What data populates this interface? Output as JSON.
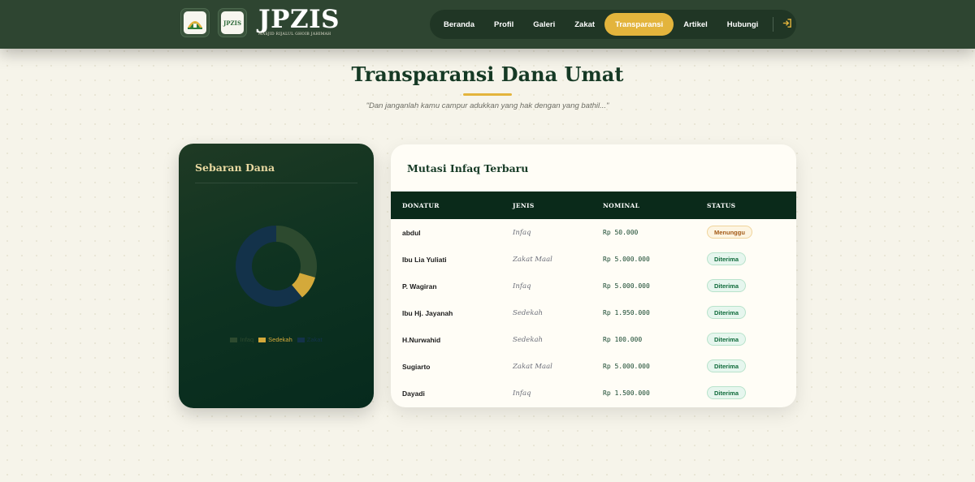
{
  "header": {
    "brand_title": "JPZIS",
    "brand_subtitle": "MASJID RIJALUL GHOIB JAHIMAH",
    "logo_text": "JPZIS",
    "nav": [
      {
        "label": "Beranda",
        "active": false
      },
      {
        "label": "Profil",
        "active": false
      },
      {
        "label": "Galeri",
        "active": false
      },
      {
        "label": "Zakat",
        "active": false
      },
      {
        "label": "Transparansi",
        "active": true
      },
      {
        "label": "Artikel",
        "active": false
      },
      {
        "label": "Hubungi",
        "active": false
      }
    ],
    "login_icon": "login-icon"
  },
  "page": {
    "title": "Transparansi Dana Umat",
    "quote": "\"Dan janganlah kamu campur adukkan yang hak dengan yang bathil...\""
  },
  "chart_card": {
    "title": "Sebaran Dana"
  },
  "chart_data": {
    "type": "pie",
    "categories": [
      "Infaq",
      "Sedekah",
      "Zakat"
    ],
    "values": [
      29.5,
      9.5,
      61
    ],
    "colors": [
      "#2d4a2f",
      "#d4a93a",
      "#13324a"
    ],
    "legend": "bottom",
    "title": "Sebaran Dana"
  },
  "table_card": {
    "title": "Mutasi Infaq Terbaru",
    "columns": [
      "DONATUR",
      "JENIS",
      "NOMINAL",
      "STATUS"
    ],
    "rows": [
      {
        "donatur": "abdul",
        "jenis": "Infaq",
        "nominal": "Rp 50.000",
        "status": "Menunggu",
        "state": "wait"
      },
      {
        "donatur": "Ibu Lia Yuliati",
        "jenis": "Zakat Maal",
        "nominal": "Rp 5.000.000",
        "status": "Diterima",
        "state": "ok"
      },
      {
        "donatur": "P. Wagiran",
        "jenis": "Infaq",
        "nominal": "Rp 5.000.000",
        "status": "Diterima",
        "state": "ok"
      },
      {
        "donatur": "Ibu Hj. Jayanah",
        "jenis": "Sedekah",
        "nominal": "Rp 1.950.000",
        "status": "Diterima",
        "state": "ok"
      },
      {
        "donatur": "H.Nurwahid",
        "jenis": "Sedekah",
        "nominal": "Rp 100.000",
        "status": "Diterima",
        "state": "ok"
      },
      {
        "donatur": "Sugiarto",
        "jenis": "Zakat Maal",
        "nominal": "Rp 5.000.000",
        "status": "Diterima",
        "state": "ok"
      },
      {
        "donatur": "Dayadi",
        "jenis": "Infaq",
        "nominal": "Rp 1.500.000",
        "status": "Diterima",
        "state": "ok"
      }
    ]
  }
}
